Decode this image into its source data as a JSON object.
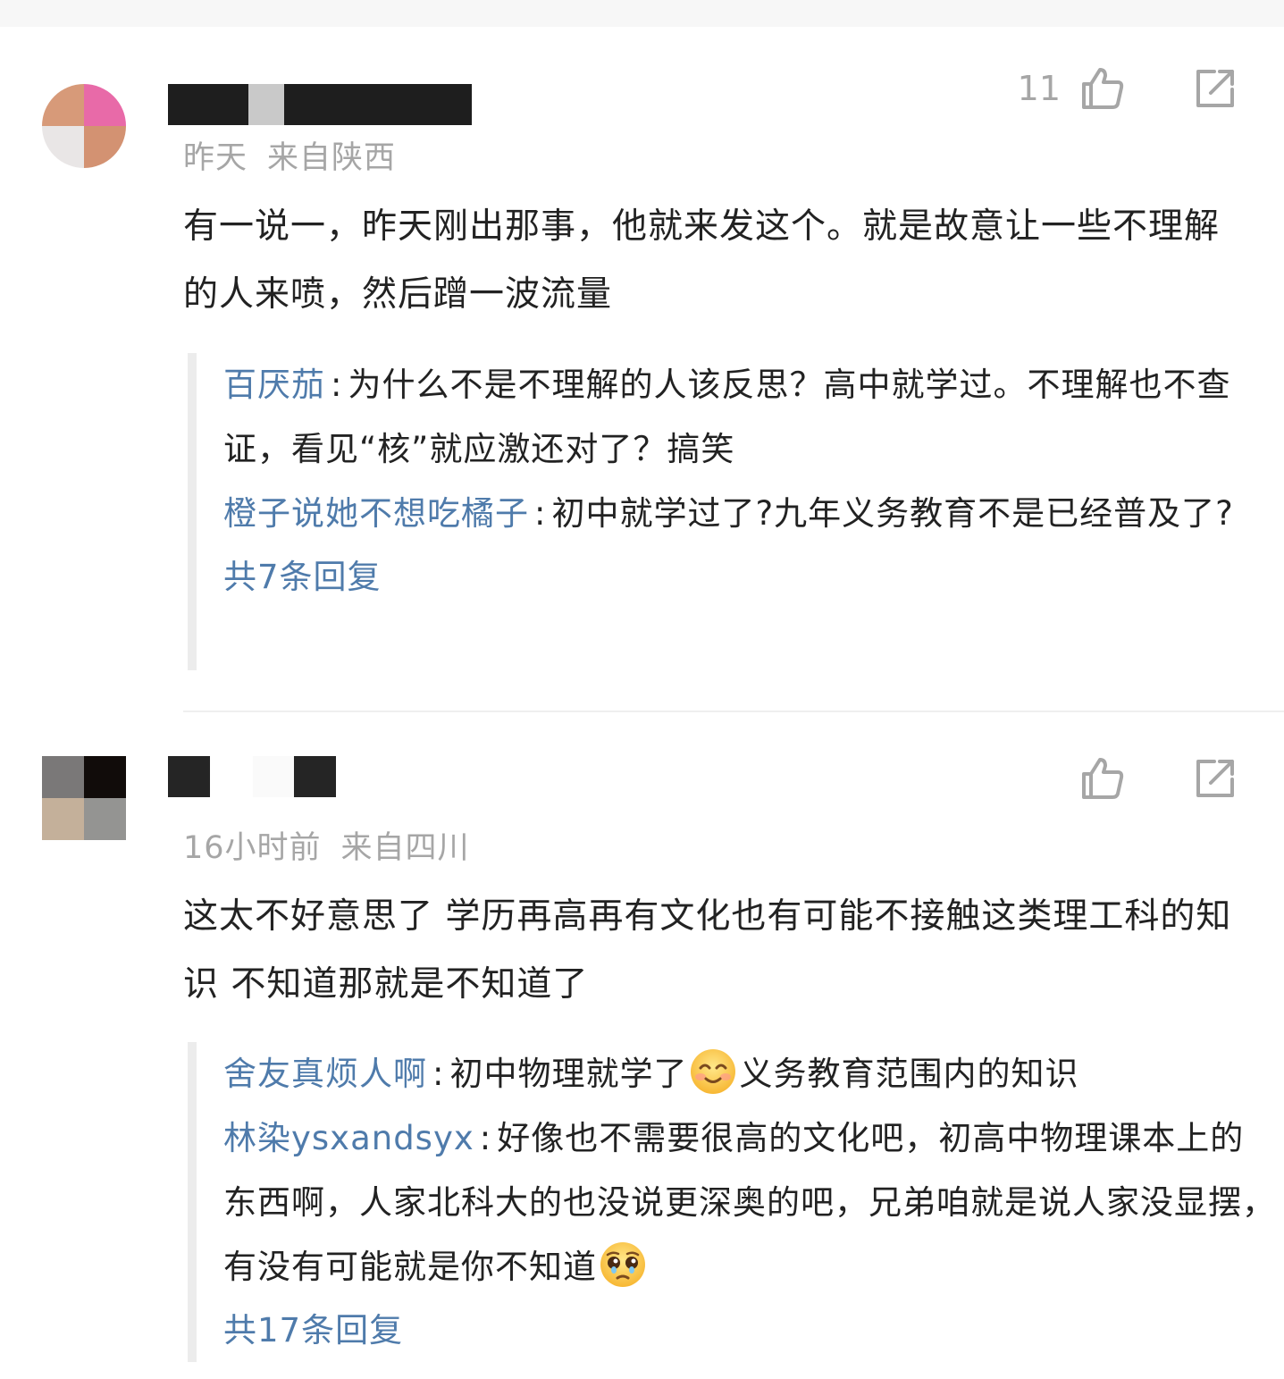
{
  "comments": [
    {
      "time": "昨天",
      "location": "来自陕西",
      "likes": "11",
      "text": "有一说一，昨天刚出那事，他就来发这个。就是故意让一些不理解的人来喷，然后蹭一波流量",
      "replies": [
        {
          "name": "百厌茄",
          "sep": ":",
          "text": "为什么不是不理解的人该反思？高中就学过。不理解也不查证，看见“核”就应激还对了？搞笑"
        },
        {
          "name": "橙子说她不想吃橘子",
          "sep": ":",
          "text": "初中就学过了?九年义务教育不是已经普及了?"
        }
      ],
      "more_replies": "共7条回复"
    },
    {
      "time": "16小时前",
      "location": "来自四川",
      "likes": "",
      "text": "这太不好意思了 学历再高再有文化也有可能不接触这类理工科的知识 不知道那就是不知道了",
      "replies": [
        {
          "name": "舍友真烦人啊",
          "sep": ":",
          "text_before": "初中物理就学了",
          "emoji": "smile-emoji",
          "text_after": "义务教育范围内的知识"
        },
        {
          "name": "林染ysxandsyx",
          "sep": ":",
          "text_before": "好像也不需要很高的文化吧，初高中物理课本上的东西啊，人家北科大的也没说更深奥的吧，兄弟咱就是说人家没显摆，有没有可能就是你不知道",
          "emoji": "pleading-emoji",
          "text_after": ""
        }
      ],
      "more_replies": "共17条回复"
    }
  ],
  "icons": {
    "like": "thumbs-up-icon",
    "share": "share-icon"
  },
  "colors": {
    "link": "#4f7bab",
    "meta": "#a6a6a6",
    "text": "#222222",
    "reply_bar": "#ececec"
  }
}
